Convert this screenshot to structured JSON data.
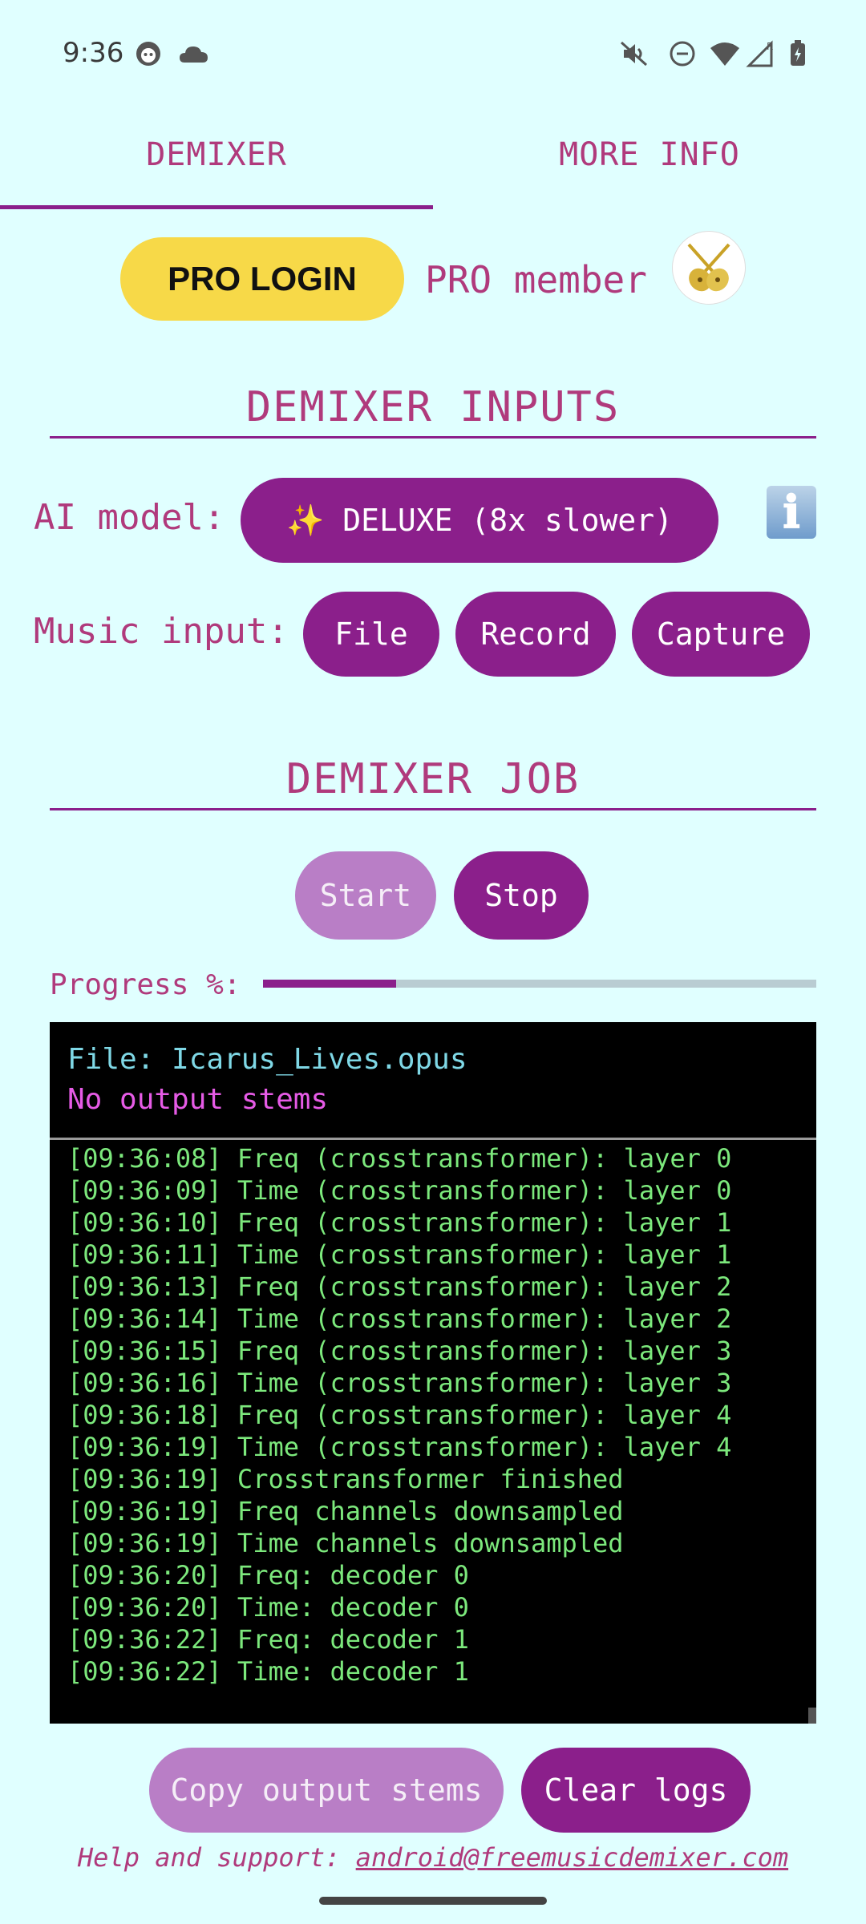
{
  "status_bar": {
    "time": "9:36",
    "icons": [
      "face-icon",
      "cloud-icon",
      "mute-icon",
      "dnd-icon",
      "wifi-icon",
      "signal-icon",
      "battery-icon"
    ]
  },
  "tabs": [
    {
      "label": "DEMIXER",
      "selected": true
    },
    {
      "label": "MORE INFO",
      "selected": false
    }
  ],
  "pro": {
    "login_label": "PRO LOGIN",
    "member_text": "PRO member",
    "avatar_icon": "guitar-icon"
  },
  "inputs": {
    "title": "DEMIXER INPUTS",
    "model_label": "AI model:",
    "model_value": "✨ DELUXE (8x slower)",
    "info_icon": "ℹ",
    "music_label": "Music input:",
    "file_label": "File",
    "record_label": "Record",
    "capture_label": "Capture"
  },
  "job": {
    "title": "DEMIXER JOB",
    "start_label": "Start",
    "stop_label": "Stop",
    "progress_label": "Progress %:",
    "progress_fraction": 0.24
  },
  "console": {
    "file_line": "File: Icarus_Lives.opus",
    "stems_line": "No output stems",
    "logs": [
      "[09:36:08] Freq (crosstransformer): layer 0",
      "[09:36:09] Time (crosstransformer): layer 0",
      "[09:36:10] Freq (crosstransformer): layer 1",
      "[09:36:11] Time (crosstransformer): layer 1",
      "[09:36:13] Freq (crosstransformer): layer 2",
      "[09:36:14] Time (crosstransformer): layer 2",
      "[09:36:15] Freq (crosstransformer): layer 3",
      "[09:36:16] Time (crosstransformer): layer 3",
      "[09:36:18] Freq (crosstransformer): layer 4",
      "[09:36:19] Time (crosstransformer): layer 4",
      "[09:36:19] Crosstransformer finished",
      "[09:36:19] Freq channels downsampled",
      "[09:36:19] Time channels downsampled",
      "[09:36:20] Freq: decoder 0",
      "[09:36:20] Time: decoder 0",
      "[09:36:22] Freq: decoder 1",
      "[09:36:22] Time: decoder 1"
    ]
  },
  "actions": {
    "copy_label": "Copy output stems",
    "clear_label": "Clear logs"
  },
  "help": {
    "prefix": "Help and support: ",
    "email": "android@freemusicdemixer.com"
  },
  "colors": {
    "background": "#E0FFFF",
    "accent": "#8B1F8B",
    "text": "#B03A7C",
    "pro_button": "#F7D948",
    "log_green": "#7CE87C",
    "file_cyan": "#7FD8E6",
    "stems_magenta": "#E65BE6"
  }
}
